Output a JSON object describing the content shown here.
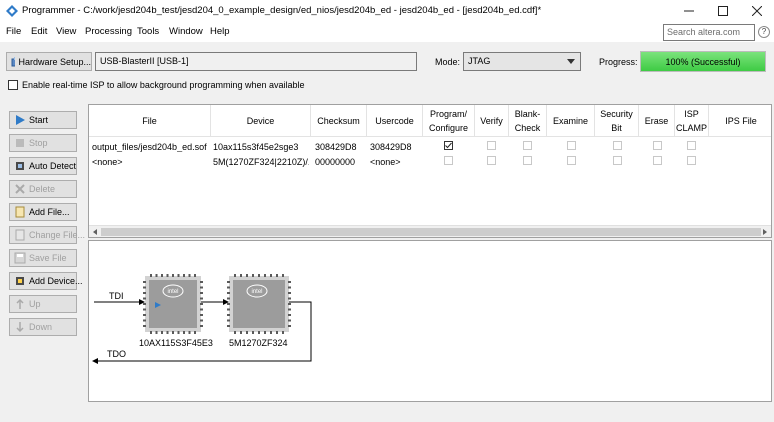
{
  "window": {
    "title": "Programmer - C:/work/jesd204b_test/jesd204_0_example_design/ed_nios/jesd204b_ed - jesd204b_ed - [jesd204b_ed.cdf]*"
  },
  "menu": {
    "items": [
      "File",
      "Edit",
      "View",
      "Processing",
      "Tools",
      "Window",
      "Help"
    ]
  },
  "search": {
    "placeholder": "Search altera.com"
  },
  "toolbar": {
    "hardware_setup_label": "Hardware Setup...",
    "hardware_value": "USB-BlasterII [USB-1]",
    "mode_label": "Mode:",
    "mode_value": "JTAG",
    "progress_label": "Progress:",
    "progress_text": "100% (Successful)",
    "progress_fraction": 1.0,
    "isp_label": "Enable real-time ISP to allow background programming when available"
  },
  "sidebar": {
    "buttons": [
      {
        "label": "Start",
        "enabled": true
      },
      {
        "label": "Stop",
        "enabled": false
      },
      {
        "label": "Auto Detect",
        "enabled": true
      },
      {
        "label": "Delete",
        "enabled": false
      },
      {
        "label": "Add File...",
        "enabled": true
      },
      {
        "label": "Change File...",
        "enabled": false
      },
      {
        "label": "Save File",
        "enabled": false
      },
      {
        "label": "Add Device...",
        "enabled": true
      },
      {
        "label": "Up",
        "enabled": false
      },
      {
        "label": "Down",
        "enabled": false
      }
    ]
  },
  "table": {
    "headers": {
      "file": "File",
      "device": "Device",
      "checksum": "Checksum",
      "usercode": "Usercode",
      "program_1": "Program/",
      "program_2": "Configure",
      "verify": "Verify",
      "blank_1": "Blank-",
      "blank_2": "Check",
      "examine": "Examine",
      "security_1": "Security",
      "security_2": "Bit",
      "erase": "Erase",
      "isp_1": "ISP",
      "isp_2": "CLAMP",
      "ips": "IPS File"
    },
    "rows": [
      {
        "file": "output_files/jesd204b_ed.sof",
        "device": "10ax115s3f45e2sge3",
        "checksum": "308429D8",
        "usercode": "308429D8",
        "program": true
      },
      {
        "file": "<none>",
        "device": "5M(1270ZF324|2210Z)/...",
        "checksum": "00000000",
        "usercode": "<none>",
        "program": false
      }
    ]
  },
  "chain": {
    "tdi": "TDI",
    "tdo": "TDO",
    "devices": [
      {
        "label": "10AX115S3F45E3",
        "logo": "intel"
      },
      {
        "label": "5M1270ZF324",
        "logo": "intel"
      }
    ]
  }
}
